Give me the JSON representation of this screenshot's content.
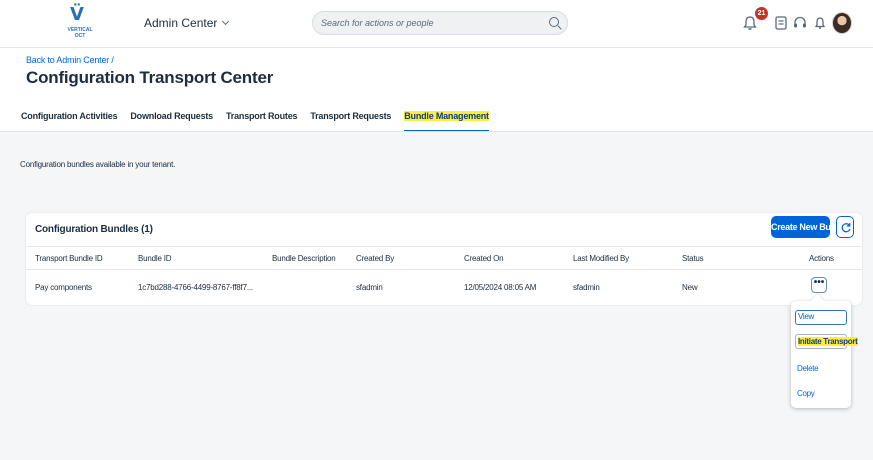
{
  "shell": {
    "logo_text": "VERTICAL\nOCT",
    "app_title": "Admin Center",
    "search_placeholder": "Search for actions or people",
    "notification_count": "21"
  },
  "header": {
    "breadcrumb": "Back to Admin Center /",
    "title": "Configuration Transport Center",
    "tabs": [
      {
        "label": "Configuration Activities"
      },
      {
        "label": "Download Requests"
      },
      {
        "label": "Transport Routes"
      },
      {
        "label": "Transport Requests"
      },
      {
        "label": "Bundle Management",
        "selected": true
      }
    ]
  },
  "note": "Configuration bundles available in your tenant.",
  "table": {
    "title": "Configuration Bundles (1)",
    "create_label": "Create New Bundle",
    "columns": [
      "Transport Bundle ID",
      "Bundle ID",
      "Bundle Description",
      "Created By",
      "Created On",
      "Last Modified By",
      "Status",
      "Actions"
    ],
    "rows": [
      {
        "transport_bundle_id": "Pay components",
        "bundle_id": "1c7bd288-4766-4499-8767-ff8f7...",
        "bundle_description": "",
        "created_by": "sfadmin",
        "created_on": "12/05/2024 08:05 AM",
        "last_modified_by": "sfadmin",
        "status": "New",
        "actions_label": "•••"
      }
    ]
  },
  "menu": {
    "items": [
      "View",
      "Initiate Transport",
      "Delete",
      "Copy"
    ]
  },
  "colors": {
    "brand_blue": "#0064d9",
    "highlight": "#ffef3a",
    "badge_red": "#c6312b"
  }
}
